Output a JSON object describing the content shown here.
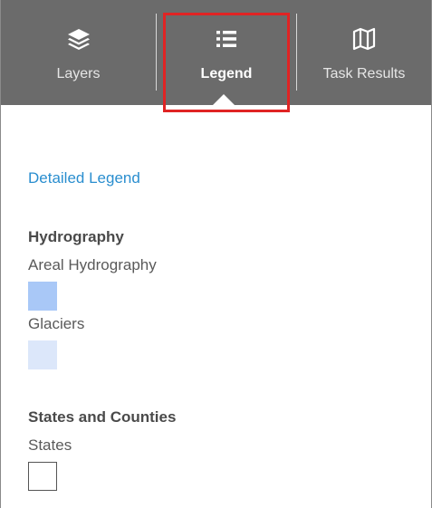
{
  "tabs": [
    {
      "label": "Layers",
      "icon": "layers-icon",
      "active": false
    },
    {
      "label": "Legend",
      "icon": "list-icon",
      "active": true
    },
    {
      "label": "Task Results",
      "icon": "map-icon",
      "active": false
    }
  ],
  "legend": {
    "detailed_link": "Detailed Legend",
    "groups": [
      {
        "title": "Hydrography",
        "items": [
          {
            "label": "Areal Hydrography",
            "color": "#a9c8f7"
          },
          {
            "label": "Glaciers",
            "color": "#dce7fa"
          }
        ]
      },
      {
        "title": "States and Counties",
        "items": [
          {
            "label": "States",
            "color": "#ffffff",
            "outline": "#555555"
          }
        ]
      }
    ]
  },
  "colors": {
    "tabbar_bg": "#6b6b6b",
    "highlight": "#e02424",
    "link": "#2a8ecf"
  }
}
